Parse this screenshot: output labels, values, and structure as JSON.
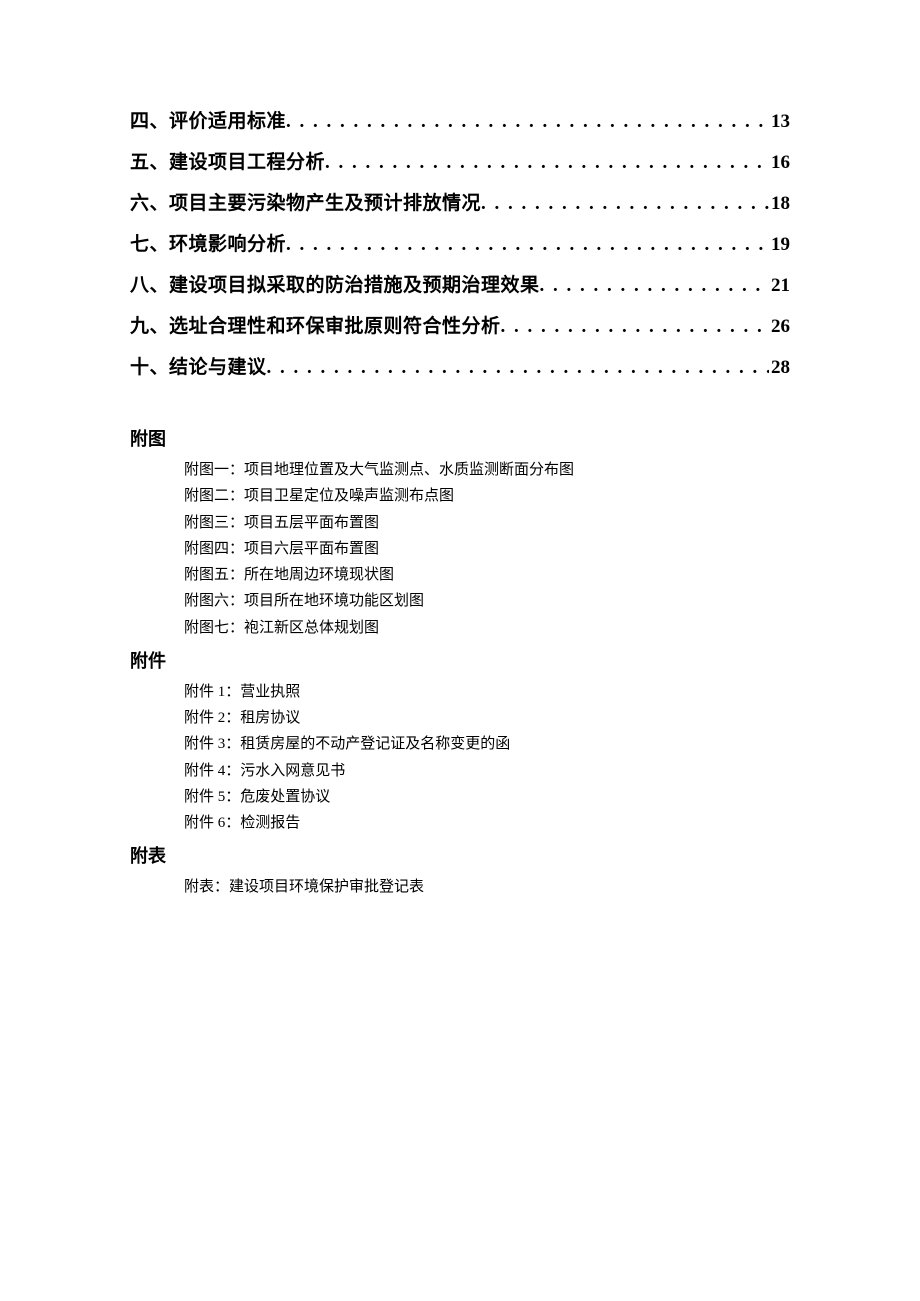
{
  "toc": [
    {
      "title": "四、评价适用标准",
      "page": "13"
    },
    {
      "title": "五、建设项目工程分析",
      "page": "16"
    },
    {
      "title": "六、项目主要污染物产生及预计排放情况",
      "page": "18"
    },
    {
      "title": "七、环境影响分析",
      "page": "19"
    },
    {
      "title": "八、建设项目拟采取的防治措施及预期治理效果",
      "page": "21"
    },
    {
      "title": "九、选址合理性和环保审批原则符合性分析",
      "page": "26"
    },
    {
      "title": "十、结论与建议",
      "page": "28"
    }
  ],
  "sections": {
    "futu": {
      "heading": "附图",
      "items": [
        "附图一：项目地理位置及大气监测点、水质监测断面分布图",
        "附图二：项目卫星定位及噪声监测布点图",
        "附图三：项目五层平面布置图",
        "附图四：项目六层平面布置图",
        "附图五：所在地周边环境现状图",
        "附图六：项目所在地环境功能区划图",
        "附图七：袍江新区总体规划图"
      ]
    },
    "fujian": {
      "heading": "附件",
      "items": [
        {
          "num": "附件 1：",
          "text": "营业执照"
        },
        {
          "num": "附件 2：",
          "text": "租房协议"
        },
        {
          "num": "附件 3：",
          "text": "租赁房屋的不动产登记证及名称变更的函"
        },
        {
          "num": "附件 4：",
          "text": "污水入网意见书"
        },
        {
          "num": "附件 5：",
          "text": "危废处置协议"
        },
        {
          "num": "附件 6：",
          "text": "检测报告"
        }
      ]
    },
    "fubiao": {
      "heading": "附表",
      "items": [
        "附表：建设项目环境保护审批登记表"
      ]
    }
  }
}
